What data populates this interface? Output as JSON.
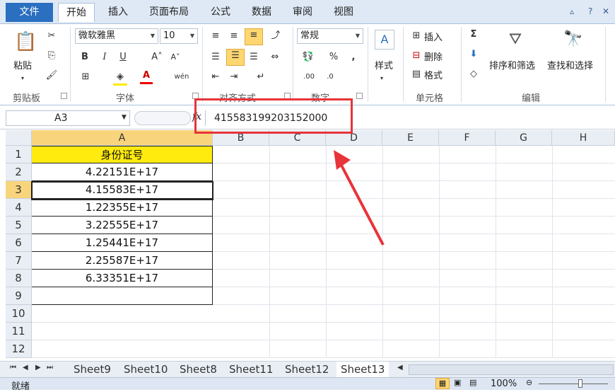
{
  "ribbon_tabs": [
    "文件",
    "开始",
    "插入",
    "页面布局",
    "公式",
    "数据",
    "审阅",
    "视图"
  ],
  "active_tab": "开始",
  "clipboard": {
    "paste": "粘贴",
    "label": "剪贴板"
  },
  "font": {
    "name": "微软雅黑",
    "size": "10",
    "label": "字体",
    "bold": "B",
    "italic": "I",
    "underline": "U"
  },
  "alignment": {
    "label": "对齐方式"
  },
  "number": {
    "format": "常规",
    "percent": "%",
    "comma": ",",
    "label": "数字"
  },
  "styles": {
    "label": "样式"
  },
  "cells": {
    "insert": "插入",
    "delete": "删除",
    "format": "格式",
    "label": "单元格"
  },
  "editing": {
    "sum": "Σ",
    "sort_filter": "排序和筛选",
    "find_select": "查找和选择",
    "label": "编辑"
  },
  "formula_bar": {
    "name_box": "A3",
    "fx": "fx",
    "value": "415583199203152000"
  },
  "columns": [
    "A",
    "B",
    "C",
    "D",
    "E",
    "F",
    "G",
    "H"
  ],
  "rows": [
    "1",
    "2",
    "3",
    "4",
    "5",
    "6",
    "7",
    "8",
    "9",
    "10",
    "11",
    "12"
  ],
  "column_a": [
    "身份证号",
    "4.22151E+17",
    "4.15583E+17",
    "1.22355E+17",
    "3.22555E+17",
    "1.25441E+17",
    "2.25587E+17",
    "6.33351E+17",
    ""
  ],
  "sheets": [
    "Sheet9",
    "Sheet10",
    "Sheet8",
    "Sheet11",
    "Sheet12",
    "Sheet13"
  ],
  "active_sheet": "Sheet13",
  "status": {
    "ready": "就绪",
    "zoom": "100%"
  },
  "colors": {
    "header_fill": "#ffeb0d",
    "accent": "#2a6fc0",
    "annotation": "#e8343a"
  }
}
